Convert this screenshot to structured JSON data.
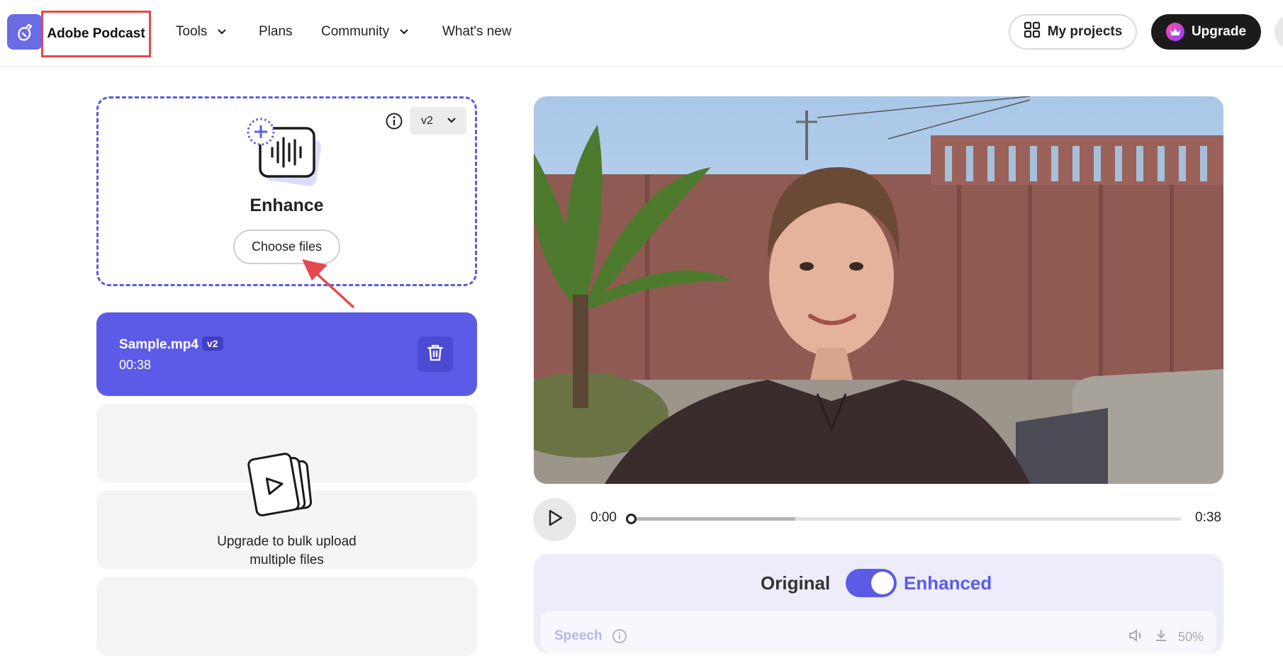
{
  "header": {
    "brand": "Adobe Podcast",
    "nav": [
      {
        "label": "Tools",
        "has_dropdown": true
      },
      {
        "label": "Plans",
        "has_dropdown": false
      },
      {
        "label": "Community",
        "has_dropdown": true
      },
      {
        "label": "What's new",
        "has_dropdown": false
      }
    ],
    "my_projects_label": "My projects",
    "upgrade_label": "Upgrade"
  },
  "enhance_panel": {
    "title": "Enhance",
    "choose_files_label": "Choose files",
    "version": "v2"
  },
  "file": {
    "name": "Sample.mp4",
    "badge": "v2",
    "duration": "00:38"
  },
  "bulk_upload": {
    "line1": "Upgrade to bulk upload",
    "line2": "multiple files"
  },
  "player": {
    "current_time": "0:00",
    "total_time": "0:38",
    "buffered_fraction": 0.3
  },
  "compare": {
    "original_label": "Original",
    "enhanced_label": "Enhanced",
    "toggle_on": true
  },
  "speech": {
    "label": "Speech",
    "level": "50%"
  },
  "colors": {
    "accent": "#5b5be8",
    "annotation_red": "#e5484d",
    "upgrade_bg": "#1b1b1b"
  }
}
